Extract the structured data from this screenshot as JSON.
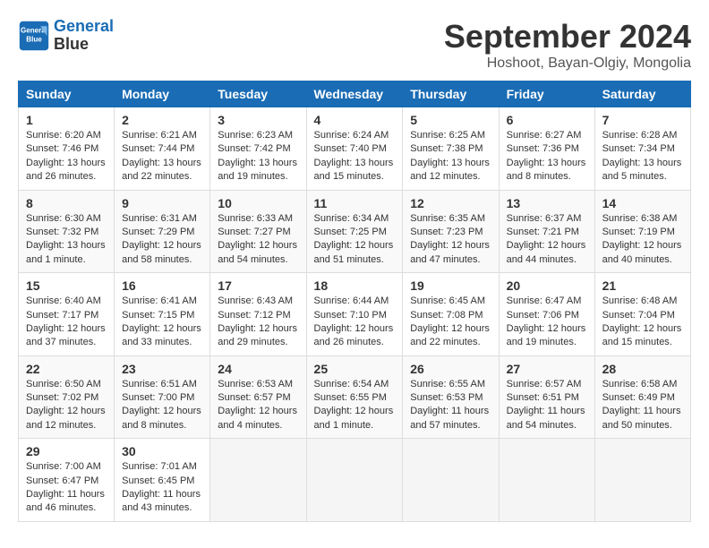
{
  "logo": {
    "line1": "General",
    "line2": "Blue"
  },
  "title": "September 2024",
  "location": "Hoshoot, Bayan-Olgiy, Mongolia",
  "days_of_week": [
    "Sunday",
    "Monday",
    "Tuesday",
    "Wednesday",
    "Thursday",
    "Friday",
    "Saturday"
  ],
  "weeks": [
    [
      {
        "day": "1",
        "sunrise": "6:20 AM",
        "sunset": "7:46 PM",
        "daylight": "13 hours and 26 minutes."
      },
      {
        "day": "2",
        "sunrise": "6:21 AM",
        "sunset": "7:44 PM",
        "daylight": "13 hours and 22 minutes."
      },
      {
        "day": "3",
        "sunrise": "6:23 AM",
        "sunset": "7:42 PM",
        "daylight": "13 hours and 19 minutes."
      },
      {
        "day": "4",
        "sunrise": "6:24 AM",
        "sunset": "7:40 PM",
        "daylight": "13 hours and 15 minutes."
      },
      {
        "day": "5",
        "sunrise": "6:25 AM",
        "sunset": "7:38 PM",
        "daylight": "13 hours and 12 minutes."
      },
      {
        "day": "6",
        "sunrise": "6:27 AM",
        "sunset": "7:36 PM",
        "daylight": "13 hours and 8 minutes."
      },
      {
        "day": "7",
        "sunrise": "6:28 AM",
        "sunset": "7:34 PM",
        "daylight": "13 hours and 5 minutes."
      }
    ],
    [
      {
        "day": "8",
        "sunrise": "6:30 AM",
        "sunset": "7:32 PM",
        "daylight": "13 hours and 1 minute."
      },
      {
        "day": "9",
        "sunrise": "6:31 AM",
        "sunset": "7:29 PM",
        "daylight": "12 hours and 58 minutes."
      },
      {
        "day": "10",
        "sunrise": "6:33 AM",
        "sunset": "7:27 PM",
        "daylight": "12 hours and 54 minutes."
      },
      {
        "day": "11",
        "sunrise": "6:34 AM",
        "sunset": "7:25 PM",
        "daylight": "12 hours and 51 minutes."
      },
      {
        "day": "12",
        "sunrise": "6:35 AM",
        "sunset": "7:23 PM",
        "daylight": "12 hours and 47 minutes."
      },
      {
        "day": "13",
        "sunrise": "6:37 AM",
        "sunset": "7:21 PM",
        "daylight": "12 hours and 44 minutes."
      },
      {
        "day": "14",
        "sunrise": "6:38 AM",
        "sunset": "7:19 PM",
        "daylight": "12 hours and 40 minutes."
      }
    ],
    [
      {
        "day": "15",
        "sunrise": "6:40 AM",
        "sunset": "7:17 PM",
        "daylight": "12 hours and 37 minutes."
      },
      {
        "day": "16",
        "sunrise": "6:41 AM",
        "sunset": "7:15 PM",
        "daylight": "12 hours and 33 minutes."
      },
      {
        "day": "17",
        "sunrise": "6:43 AM",
        "sunset": "7:12 PM",
        "daylight": "12 hours and 29 minutes."
      },
      {
        "day": "18",
        "sunrise": "6:44 AM",
        "sunset": "7:10 PM",
        "daylight": "12 hours and 26 minutes."
      },
      {
        "day": "19",
        "sunrise": "6:45 AM",
        "sunset": "7:08 PM",
        "daylight": "12 hours and 22 minutes."
      },
      {
        "day": "20",
        "sunrise": "6:47 AM",
        "sunset": "7:06 PM",
        "daylight": "12 hours and 19 minutes."
      },
      {
        "day": "21",
        "sunrise": "6:48 AM",
        "sunset": "7:04 PM",
        "daylight": "12 hours and 15 minutes."
      }
    ],
    [
      {
        "day": "22",
        "sunrise": "6:50 AM",
        "sunset": "7:02 PM",
        "daylight": "12 hours and 12 minutes."
      },
      {
        "day": "23",
        "sunrise": "6:51 AM",
        "sunset": "7:00 PM",
        "daylight": "12 hours and 8 minutes."
      },
      {
        "day": "24",
        "sunrise": "6:53 AM",
        "sunset": "6:57 PM",
        "daylight": "12 hours and 4 minutes."
      },
      {
        "day": "25",
        "sunrise": "6:54 AM",
        "sunset": "6:55 PM",
        "daylight": "12 hours and 1 minute."
      },
      {
        "day": "26",
        "sunrise": "6:55 AM",
        "sunset": "6:53 PM",
        "daylight": "11 hours and 57 minutes."
      },
      {
        "day": "27",
        "sunrise": "6:57 AM",
        "sunset": "6:51 PM",
        "daylight": "11 hours and 54 minutes."
      },
      {
        "day": "28",
        "sunrise": "6:58 AM",
        "sunset": "6:49 PM",
        "daylight": "11 hours and 50 minutes."
      }
    ],
    [
      {
        "day": "29",
        "sunrise": "7:00 AM",
        "sunset": "6:47 PM",
        "daylight": "11 hours and 46 minutes."
      },
      {
        "day": "30",
        "sunrise": "7:01 AM",
        "sunset": "6:45 PM",
        "daylight": "11 hours and 43 minutes."
      },
      null,
      null,
      null,
      null,
      null
    ]
  ]
}
